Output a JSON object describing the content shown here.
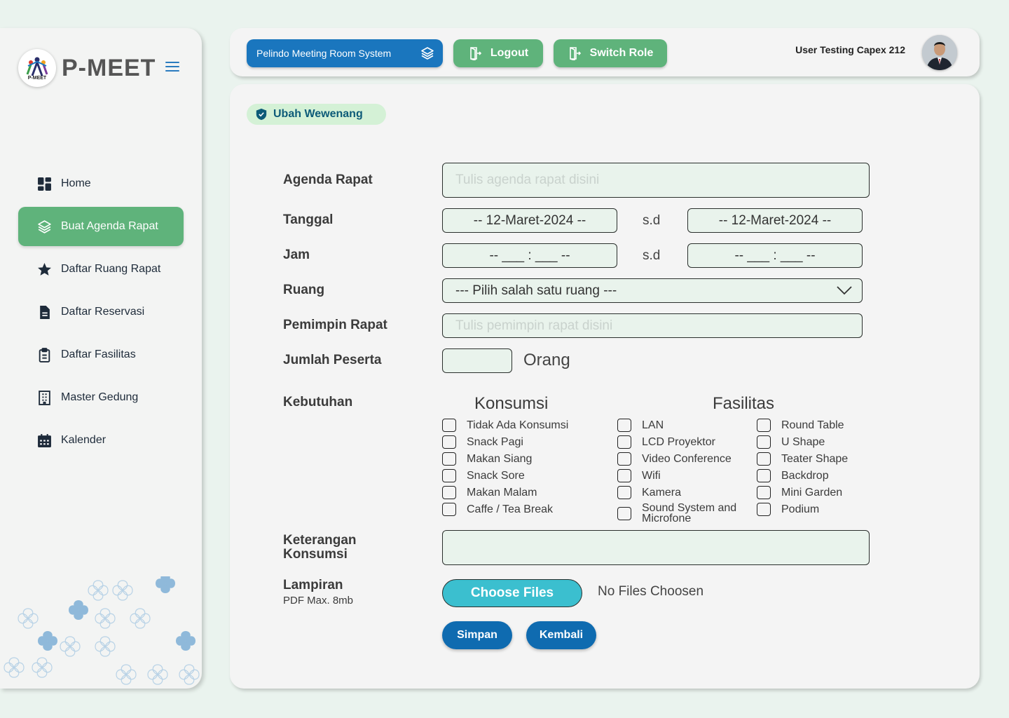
{
  "brand": {
    "name": "P-MEET",
    "logo_sub": "P-MEET"
  },
  "sidebar": {
    "items": [
      {
        "label": "Home",
        "icon": "dashboard-icon"
      },
      {
        "label": "Buat Agenda Rapat",
        "icon": "layers-icon",
        "active": true
      },
      {
        "label": "Daftar Ruang Rapat",
        "icon": "star-icon"
      },
      {
        "label": "Daftar Reservasi",
        "icon": "document-icon"
      },
      {
        "label": "Daftar Fasilitas",
        "icon": "clipboard-icon"
      },
      {
        "label": "Master Gedung",
        "icon": "building-icon"
      },
      {
        "label": "Kalender",
        "icon": "calendar-icon"
      }
    ]
  },
  "header": {
    "system_name": "Pelindo Meeting Room System",
    "logout_label": "Logout",
    "switch_role_label": "Switch Role",
    "user_name": "User Testing Capex 212"
  },
  "page": {
    "badge": "Ubah Wewenang"
  },
  "form": {
    "agenda": {
      "label": "Agenda Rapat",
      "placeholder": "Tulis agenda rapat disini"
    },
    "tanggal": {
      "label": "Tanggal",
      "start": "-- 12-Maret-2024 --",
      "sep": "s.d",
      "end": "-- 12-Maret-2024 --"
    },
    "jam": {
      "label": "Jam",
      "start": "-- ___ : ___ --",
      "sep": "s.d",
      "end": "-- ___ : ___ --"
    },
    "ruang": {
      "label": "Ruang",
      "value": "--- Pilih salah satu ruang ---"
    },
    "pemimpin": {
      "label": "Pemimpin Rapat",
      "placeholder": "Tulis pemimpin rapat disini"
    },
    "peserta": {
      "label": "Jumlah Peserta",
      "unit": "Orang"
    },
    "kebutuhan": {
      "label": "Kebutuhan",
      "konsumsi_title": "Konsumsi",
      "fasilitas_title": "Fasilitas",
      "konsumsi": [
        "Tidak Ada Konsumsi",
        "Snack Pagi",
        "Makan Siang",
        "Snack Sore",
        "Makan Malam",
        "Caffe / Tea Break"
      ],
      "fasilitas_a": [
        "LAN",
        "LCD Proyektor",
        "Video Conference",
        "Wifi",
        "Kamera",
        "Sound System and Microfone"
      ],
      "fasilitas_b": [
        "Round Table",
        "U Shape",
        "Teater Shape",
        "Backdrop",
        "Mini Garden",
        "Podium"
      ]
    },
    "keterangan": {
      "label_line1": "Keterangan",
      "label_line2": "Konsumsi"
    },
    "lampiran": {
      "label": "Lampiran",
      "sub": "PDF Max. 8mb",
      "choose_label": "Choose Files",
      "no_file": "No Files Choosen"
    },
    "simpan_label": "Simpan",
    "kembali_label": "Kembali"
  },
  "colors": {
    "primary_blue": "#1a76be",
    "green": "#5fb37b",
    "cyan": "#3bbfcf",
    "field_bg": "#e9f3ec"
  }
}
